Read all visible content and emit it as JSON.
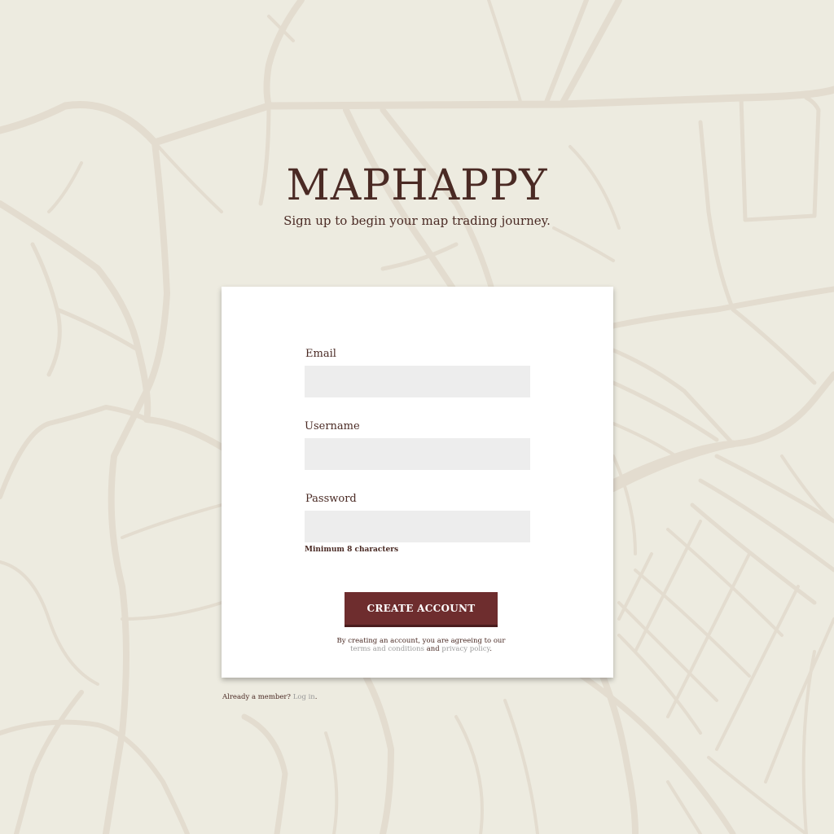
{
  "brand": {
    "title": "MAPHAPPY",
    "tagline": "Sign up to begin your map trading journey."
  },
  "form": {
    "email_label": "Email",
    "email_value": "",
    "username_label": "Username",
    "username_value": "",
    "password_label": "Password",
    "password_value": "",
    "password_hint": "Minimum 8 characters",
    "submit_label": "CREATE ACCOUNT"
  },
  "legal": {
    "prefix": "By creating an account, you are agreeing to our",
    "terms_link": "terms and conditions",
    "conjunction": "and",
    "privacy_link": "privacy policy",
    "suffix": "."
  },
  "login": {
    "prompt": "Already a member?",
    "link": "Log in",
    "suffix": "."
  },
  "colors": {
    "background": "#edebe0",
    "map_lines": "#e3dccf",
    "text": "#4a2a24",
    "button": "#6e2d2e",
    "input_bg": "#ededed",
    "link": "#9a9a9a"
  }
}
